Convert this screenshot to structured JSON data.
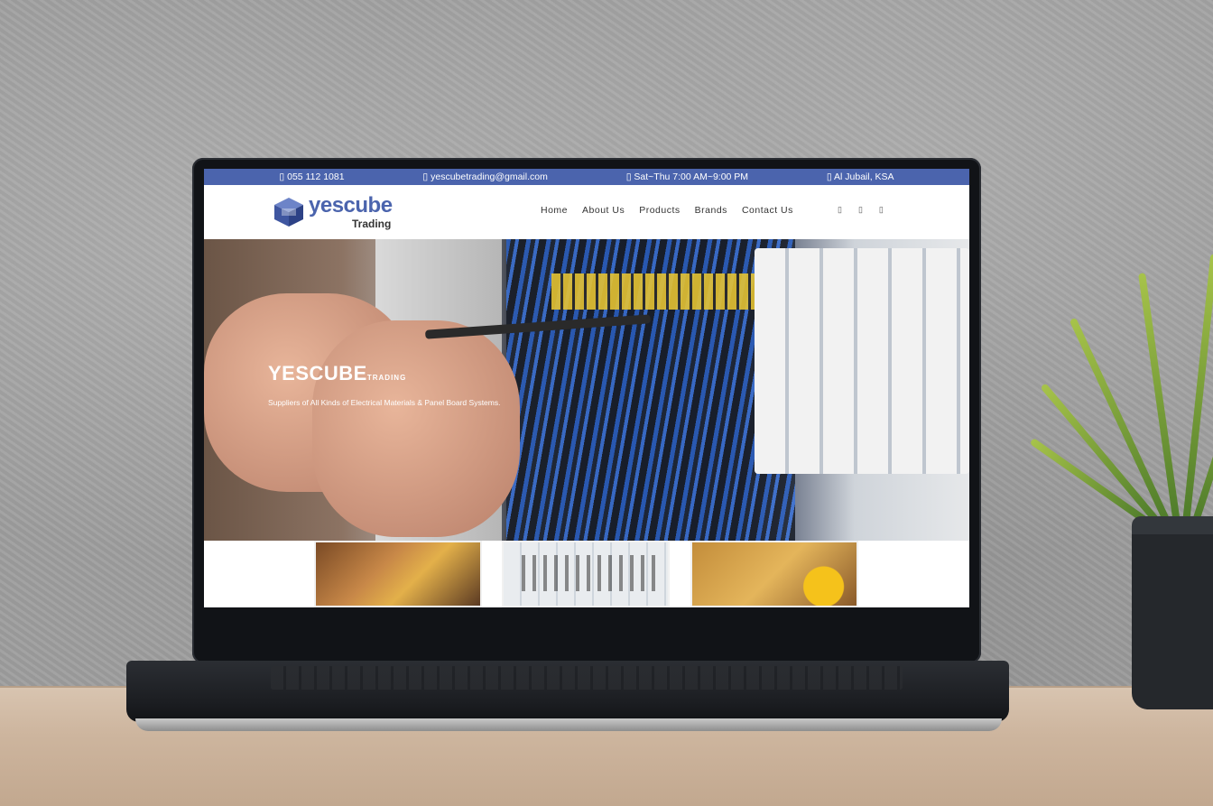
{
  "topbar": {
    "phone": "055 112 1081",
    "email": "yescubetrading@gmail.com",
    "hours": "Sat~Thu 7:00 AM~9:00 PM",
    "location": "Al Jubail, KSA"
  },
  "brand": {
    "name": "yescube",
    "sub": "Trading"
  },
  "nav": {
    "items": [
      "Home",
      "About Us",
      "Products",
      "Brands",
      "Contact Us"
    ]
  },
  "social": [
    "",
    "",
    ""
  ],
  "hero": {
    "title": "YESCUBE",
    "title_small": "TRADING",
    "subtitle": "Suppliers of All Kinds of Electrical Materials & Panel Board Systems."
  },
  "colors": {
    "brand_blue": "#4b64ad"
  }
}
